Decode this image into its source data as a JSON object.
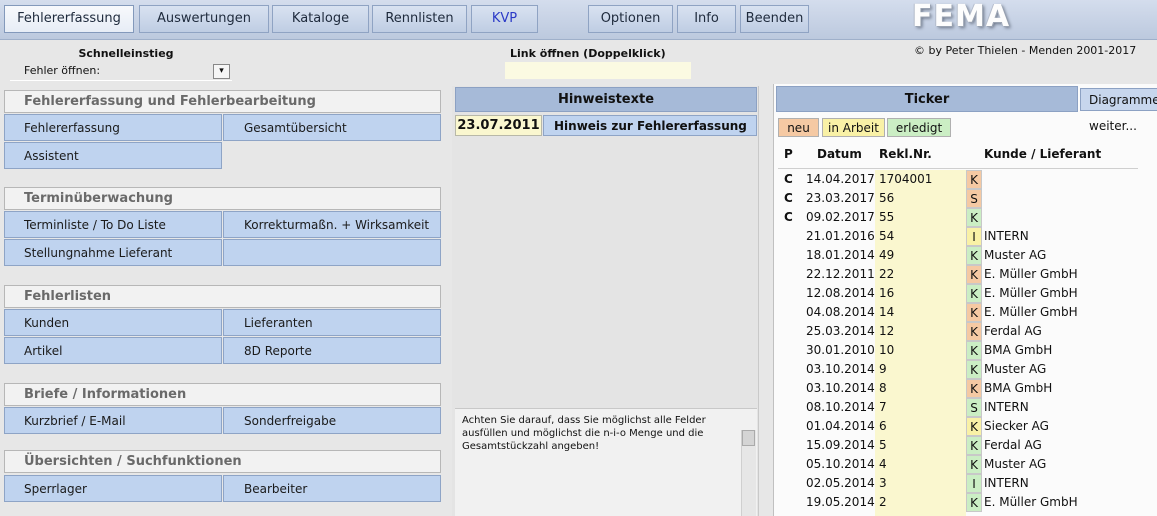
{
  "nav": {
    "tabs": [
      "Fehlererfassung",
      "Auswertungen",
      "Kataloge",
      "Rennlisten",
      "KVP"
    ],
    "right": [
      "Optionen",
      "Info",
      "Beenden"
    ],
    "logo": "FEMA"
  },
  "quick": {
    "title": "Schnelleinstieg",
    "label": "Fehler öffnen:",
    "dropdown_arrow": "▾"
  },
  "link": {
    "title": "Link öffnen (Doppelklick)"
  },
  "copyright": "© by Peter Thielen - Menden 2001-2017",
  "sections": [
    {
      "title": "Fehlererfassung und Fehlerbearbeitung",
      "buttons": [
        "Fehlererfassung",
        "Gesamtübersicht",
        "Assistent"
      ]
    },
    {
      "title": "Terminüberwachung",
      "buttons": [
        "Terminliste / To Do Liste",
        "Korrekturmaßn. + Wirksamkeit",
        "Stellungnahme Lieferant",
        ""
      ]
    },
    {
      "title": "Fehlerlisten",
      "buttons": [
        "Kunden",
        "Lieferanten",
        "Artikel",
        "8D Reporte"
      ]
    },
    {
      "title": "Briefe / Informationen",
      "buttons": [
        "Kurzbrief / E-Mail",
        "Sonderfreigabe"
      ]
    },
    {
      "title": "Übersichten / Suchfunktionen",
      "buttons": [
        "Sperrlager",
        "Bearbeiter"
      ]
    }
  ],
  "hinweis": {
    "title": "Hinweistexte",
    "date": "23.07.2011",
    "text": "Hinweis zur Fehlererfassung",
    "note": "Achten Sie darauf, dass Sie möglichst alle Felder ausfüllen und möglichst die n-i-o Menge und die Gesamtstückzahl angeben!"
  },
  "ticker": {
    "title": "Ticker",
    "diagram_button": "Diagramme",
    "status_buttons": [
      "neu",
      "in Arbeit",
      "erledigt"
    ],
    "more": "weiter...",
    "headers": [
      "P",
      "Datum",
      "Rekl.Nr.",
      "Kunde / Lieferant"
    ],
    "colors": {
      "K": "#f5c9a3",
      "S": "#f5c9a3",
      "I": "#f9f1a6",
      "G": "#cbeec4"
    },
    "rows": [
      {
        "p": "C",
        "datum": "14.04.2017",
        "nr": "1704001",
        "k": "K",
        "status": "neu",
        "kunde": ""
      },
      {
        "p": "C",
        "datum": "23.03.2017",
        "nr": "56",
        "k": "S",
        "status": "neu",
        "kunde": ""
      },
      {
        "p": "C",
        "datum": "09.02.2017",
        "nr": "55",
        "k": "K",
        "status": "erledigt",
        "kunde": ""
      },
      {
        "p": "",
        "datum": "21.01.2016",
        "nr": "54",
        "k": "I",
        "status": "in Arbeit",
        "kunde": "INTERN"
      },
      {
        "p": "",
        "datum": "18.01.2014",
        "nr": "49",
        "k": "K",
        "status": "erledigt",
        "kunde": "Muster AG"
      },
      {
        "p": "",
        "datum": "22.12.2011",
        "nr": "22",
        "k": "K",
        "status": "neu",
        "kunde": "E. Müller GmbH"
      },
      {
        "p": "",
        "datum": "12.08.2014",
        "nr": "16",
        "k": "K",
        "status": "erledigt",
        "kunde": "E. Müller GmbH"
      },
      {
        "p": "",
        "datum": "04.08.2014",
        "nr": "14",
        "k": "K",
        "status": "neu",
        "kunde": "E. Müller GmbH"
      },
      {
        "p": "",
        "datum": "25.03.2014",
        "nr": "12",
        "k": "K",
        "status": "neu",
        "kunde": "Ferdal AG"
      },
      {
        "p": "",
        "datum": "30.01.2010",
        "nr": "10",
        "k": "K",
        "status": "erledigt",
        "kunde": "BMA GmbH"
      },
      {
        "p": "",
        "datum": "03.10.2014",
        "nr": "9",
        "k": "K",
        "status": "erledigt",
        "kunde": "Muster AG"
      },
      {
        "p": "",
        "datum": "03.10.2014",
        "nr": "8",
        "k": "K",
        "status": "neu",
        "kunde": "BMA GmbH"
      },
      {
        "p": "",
        "datum": "08.10.2014",
        "nr": "7",
        "k": "S",
        "status": "erledigt",
        "kunde": "INTERN"
      },
      {
        "p": "",
        "datum": "01.04.2014",
        "nr": "6",
        "k": "K",
        "status": "in Arbeit",
        "kunde": "Siecker AG"
      },
      {
        "p": "",
        "datum": "15.09.2014",
        "nr": "5",
        "k": "K",
        "status": "erledigt",
        "kunde": "Ferdal AG"
      },
      {
        "p": "",
        "datum": "05.10.2014",
        "nr": "4",
        "k": "K",
        "status": "erledigt",
        "kunde": "Muster AG"
      },
      {
        "p": "",
        "datum": "02.05.2014",
        "nr": "3",
        "k": "I",
        "status": "erledigt",
        "kunde": "INTERN"
      },
      {
        "p": "",
        "datum": "19.05.2014",
        "nr": "2",
        "k": "K",
        "status": "erledigt",
        "kunde": "E. Müller GmbH"
      }
    ]
  }
}
